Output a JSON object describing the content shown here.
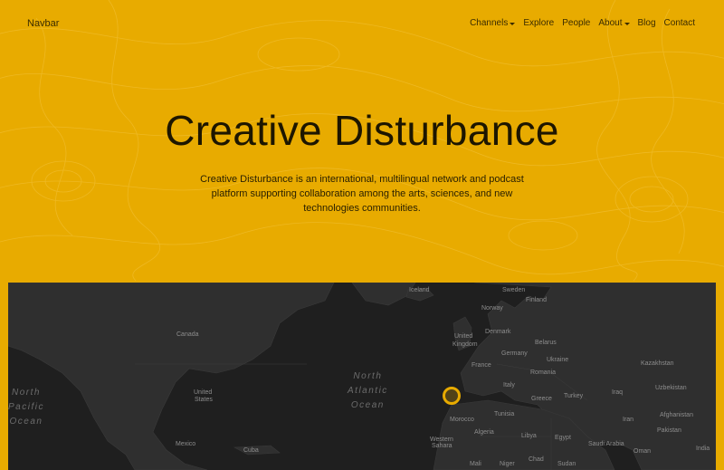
{
  "navbar": {
    "brand": "Navbar",
    "links": [
      {
        "label": "Channels",
        "dropdown": true
      },
      {
        "label": "Explore",
        "dropdown": false
      },
      {
        "label": "People",
        "dropdown": false
      },
      {
        "label": "About",
        "dropdown": true
      },
      {
        "label": "Blog",
        "dropdown": false
      },
      {
        "label": "Contact",
        "dropdown": false
      }
    ]
  },
  "hero": {
    "title": "Creative Disturbance",
    "description": "Creative Disturbance is an international, multilingual network and podcast platform supporting collaboration among the arts, sciences, and new technologies communities."
  },
  "map": {
    "oceans": {
      "north_atlantic": [
        "North",
        "Atlantic",
        "Ocean"
      ],
      "north_pacific": [
        "North",
        "Pacific",
        "Ocean"
      ]
    },
    "labels": {
      "iceland": "Iceland",
      "sweden": "Sweden",
      "finland": "Finland",
      "norway": "Norway",
      "canada": "Canada",
      "united": "United",
      "kingdom": "Kingdom",
      "denmark": "Denmark",
      "belarus": "Belarus",
      "germany": "Germany",
      "ukraine": "Ukraine",
      "kazakhstan": "Kazakhstan",
      "france": "France",
      "romania": "Romania",
      "united_states_1": "United",
      "united_states_2": "States",
      "italy": "Italy",
      "greece": "Greece",
      "turkey": "Turkey",
      "uzbekistan": "Uzbekistan",
      "iraq": "Iraq",
      "iran": "Iran",
      "afghanistan": "Afghanistan",
      "tunisia": "Tunisia",
      "morocco": "Morocco",
      "algeria": "Algeria",
      "libya": "Libya",
      "egypt": "Egypt",
      "saudi_arabia": "Saudi Arabia",
      "pakistan": "Pakistan",
      "oman": "Oman",
      "india": "India",
      "mexico": "Mexico",
      "cuba": "Cuba",
      "western": "Western",
      "sahara": "Sahara",
      "mali": "Mali",
      "niger": "Niger",
      "chad": "Chad",
      "sudan": "Sudan"
    },
    "marker_color": "#e8ab00"
  },
  "colors": {
    "accent": "#e8ab00",
    "map_background": "#1f1f1f"
  }
}
